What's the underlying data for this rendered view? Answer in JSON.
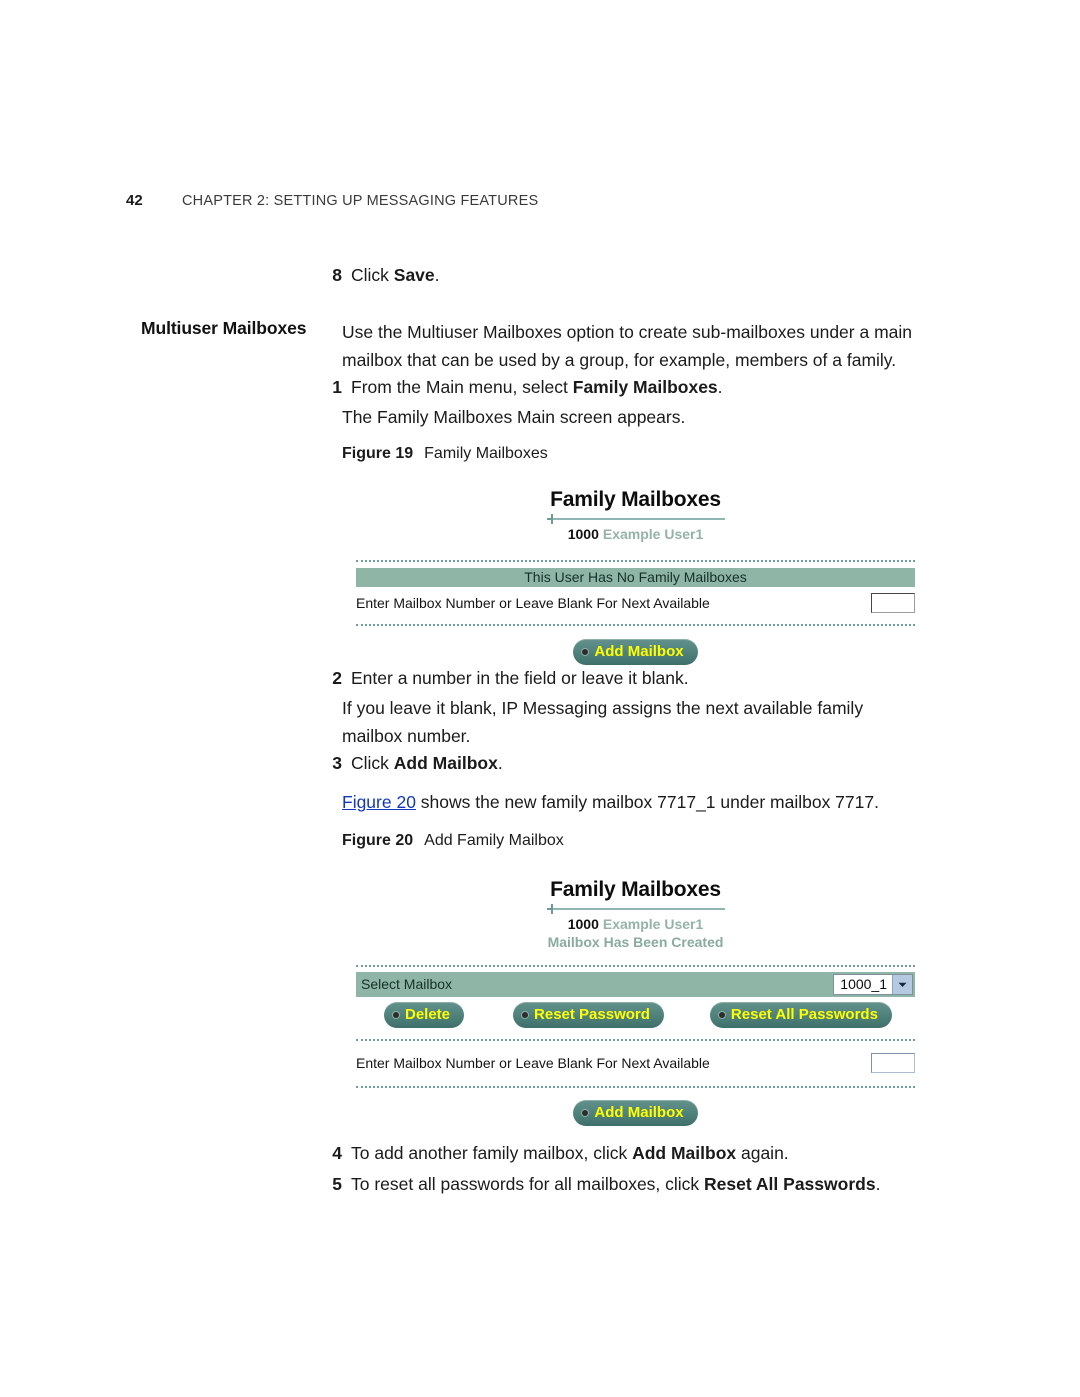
{
  "running_header": {
    "page_number": "42",
    "chapter": "CHAPTER 2: SETTING UP MESSAGING FEATURES"
  },
  "steps_top": {
    "step8_num": "8",
    "step8_pre": "Click ",
    "step8_bold": "Save",
    "step8_post": "."
  },
  "section": {
    "side_label": "Multiuser Mailboxes",
    "intro": "Use the Multiuser Mailboxes option to create sub-mailboxes under a main mailbox that can be used by a group, for example, members of a family.",
    "step1_num": "1",
    "step1_pre": "From the Main menu, select ",
    "step1_bold": "Family Mailboxes",
    "step1_post": ".",
    "step1_follow": "The Family Mailboxes Main screen appears."
  },
  "figure19": {
    "label": "Figure 19",
    "caption": "Family Mailboxes"
  },
  "screenshot1": {
    "title": "Family Mailboxes",
    "mailbox_number": "1000",
    "mailbox_name": "Example User1",
    "status_bar": "This User Has No Family Mailboxes",
    "field_label": "Enter Mailbox Number or Leave Blank For Next Available",
    "field_value": "",
    "add_button": "Add Mailbox"
  },
  "steps_mid": {
    "step2_num": "2",
    "step2_text": "Enter a number in the field or leave it blank.",
    "step2_follow": "If you leave it blank, IP Messaging assigns the next available family mailbox number.",
    "step3_num": "3",
    "step3_pre": "Click ",
    "step3_bold": "Add Mailbox",
    "step3_post": ".",
    "xref_link": "Figure 20",
    "xref_rest": " shows the new family mailbox 7717_1 under mailbox 7717."
  },
  "figure20": {
    "label": "Figure 20",
    "caption": "Add Family Mailbox"
  },
  "screenshot2": {
    "title": "Family Mailboxes",
    "mailbox_number": "1000",
    "mailbox_name": "Example User1",
    "message": "Mailbox Has Been Created",
    "select_label": "Select Mailbox",
    "select_value": "1000_1",
    "btn_delete": "Delete",
    "btn_reset_password": "Reset Password",
    "btn_reset_all": "Reset All Passwords",
    "field_label": "Enter Mailbox Number or Leave Blank For Next Available",
    "field_value": "",
    "add_button": "Add Mailbox"
  },
  "steps_bottom": {
    "step4_num": "4",
    "step4_pre": "To add another family mailbox, click ",
    "step4_bold": "Add Mailbox",
    "step4_post": " again.",
    "step5_num": "5",
    "step5_pre": "To reset all passwords for all mailboxes, click ",
    "step5_bold": "Reset All Passwords",
    "step5_post": "."
  },
  "colors": {
    "accent_green": "#8fb5a6",
    "rule_teal": "#8fb6b2",
    "button_teal": "#4f817b",
    "button_text": "#ffff00",
    "link_blue": "#1437b8",
    "select_arrow": "#b5c9e0"
  }
}
